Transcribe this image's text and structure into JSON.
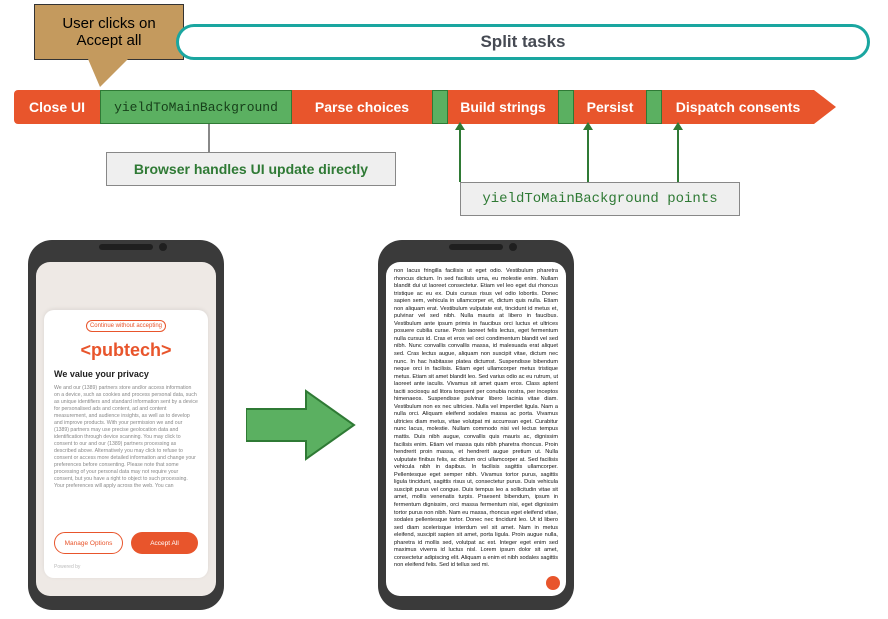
{
  "callout": {
    "text": "User clicks on Accept all"
  },
  "split_tasks_label": "Split tasks",
  "timeline": {
    "close_ui": "Close UI",
    "yield_main": "yieldToMainBackground",
    "parse_choices": "Parse choices",
    "build_strings": "Build strings",
    "persist": "Persist",
    "dispatch_consents": "Dispatch consents"
  },
  "annotations": {
    "browser_update": "Browser handles UI update directly",
    "yield_points": "yieldToMainBackground points"
  },
  "phone_consent": {
    "continue_label": "Continue without accepting",
    "logo_text": "<pubtech>",
    "title": "We value your privacy",
    "body": "We and our (1389) partners store and/or access information on a device, such as cookies and process personal data, such as unique identifiers and standard information sent by a device for personalised ads and content, ad and content measurement, and audience insights, as well as to develop and improve products. With your permission we and our (1389) partners may use precise geolocation data and identification through device scanning. You may click to consent to our and our (1389) partners processing as described above. Alternatively you may click to refuse to consent or access more detailed information and change your preferences before consenting. Please note that some processing of your personal data may not require your consent, but you have a right to object to such processing. Your preferences will apply across the web. You can",
    "manage_options": "Manage Options",
    "accept_all": "Accept All",
    "powered": "Powered by"
  },
  "phone_article": {
    "body": "non lacus fringilla facilisis ut eget odio. Vestibulum pharetra rhoncus dictum. In sed facilisis urna, eu molestie enim. Nullam blandit dui ut laoreet consectetur. Etiam vel leo eget dui rhoncus tristique ac eu ex. Duis cursus risus vel odio lobortis. Donec sapien sem, vehicula in ullamcorper et, dictum quis nulla. Etiam non aliquam erat. Vestibulum vulputate est, tincidunt id metus et, pulvinar vel sed nibh. Nulla mauris at libero in faucibus. Vestibulum ante ipsum primis in faucibus orci luctus et ultrices posuere cubilia curae. Proin laoreet felis lectus, eget fermentum nulla cursus id. Cras et eros vel orci condimentum blandit vel sed nibh. Nunc convallis convallis massa, id malesuada erat aliquet sed. Cras lectus augue, aliquam non suscipit vitae, dictum nec nunc. In hac habitasse platea dictumst. Suspendisse bibendum neque orci in facilisis. Etiam eget ullamcorper metus tristique metus. Etiam sit amet blandit leo. Sed varius odio ac eu rutrum, ut laoreet ante iaculis. Vivamus sit amet quam eros. Class aptent taciti sociosqu ad litora torquent per conubia nostra, per inceptos himenaeos. Suspendisse pulvinar libero lacinia vitae diam. Vestibulum non ex nec ultricies. Nulla vel imperdiet ligula. Nam a nulla orci. Aliquam eleifend sodales massa ac porta. Vivamus ultricies diam metus, vitae volutpat mi accumsan eget. Curabitur nunc lacus, molestie. Nullam commodo nisi vel lectus tempus mattis. Duis nibh augue, convallis quis mauris ac, dignissim facilisis enim. Etiam vel massa quis nibh pharetra rhoncus. Proin hendrerit proin massa, et hendrerit augue pretium ut. Nulla vulputate finibus felis, ac dictum orci ullamcorper at. Sed facilisis vehicula nibh in dapibus. In facilisis sagittis ullamcorper. Pellentesque eget semper nibh. Vivamus tortor purus, sagittis ligula tincidunt, sagittis risus ut, consectetur purus. Duis vehicula suscipit purus vel congue. Duis tempus leo a sollicitudin vitae sit amet, mollis venenatis turpis. Praesent bibendum, ipsum in fermentum dignissim, orci massa fermentum nisi, eget dignissim tortor purus non nibh. Nam eu massa, rhoncus eget eleifend vitae, sodales pellentesque tortor. Donec nec tincidunt leo. Ut id libero sed diam scelerisque interdum vel sit amet. Nam in metus eleifend, suscipit sapien sit amet, porta ligula. Proin augue nulla, pharetra id mollis sed, volutpat ac est. Integer eget enim sed maximus viverra id luctus nisl. Lorem ipsum dolor sit amet, consectetur adipiscing elit. Aliquam a enim et nibh sodales sagittis non eleifend felis. Sed id tellus sed mi."
  },
  "colors": {
    "orange": "#e8552c",
    "green": "#5bb061",
    "teal": "#1aa6a0",
    "tan": "#c49a5e"
  }
}
